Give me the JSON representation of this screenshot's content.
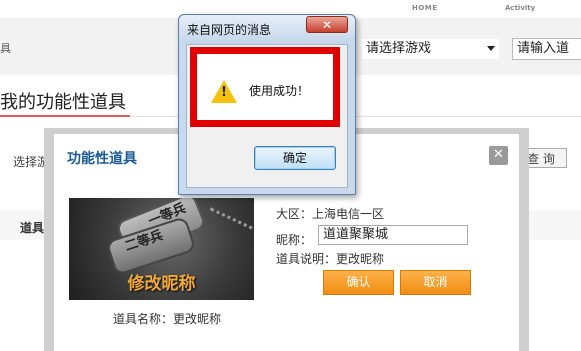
{
  "topnav": {
    "home": "HOME",
    "activity": "Activity"
  },
  "filterbar": {
    "crumb_char": "具",
    "game_select_value": "请选择游戏",
    "name_input_value": "请输入道"
  },
  "page": {
    "title": "我的功能性道具"
  },
  "background": {
    "select_label": "选择游戏",
    "query_button": "查 询",
    "col_name": "道具名"
  },
  "modal": {
    "title": "功能性道具",
    "close_symbol": "✕",
    "image_caption": "修改昵称",
    "image_tag1": "一等兵",
    "image_tag2": "二等兵",
    "item_name": "道具名称：更改昵称",
    "region": "大区：上海电信一区",
    "nick_label": "昵称：",
    "nick_value": "道道聚聚城",
    "desc": "道具说明：更改昵称",
    "confirm": "确认",
    "cancel": "取消"
  },
  "alert": {
    "title": "来自网页的消息",
    "close_symbol": "✕",
    "message": "使用成功！",
    "ok": "确定",
    "warn_icon": "warning-icon"
  },
  "colors": {
    "accent_orange": "#f28e12",
    "alert_highlight": "#e00000",
    "modal_title": "#1b5a93"
  }
}
